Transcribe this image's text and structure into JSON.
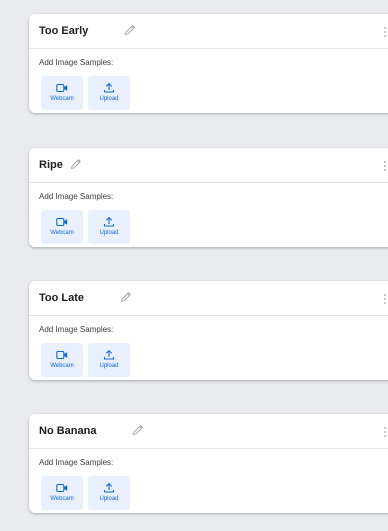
{
  "classes": [
    {
      "name": "Too Early",
      "samples_label": "Add Image Samples:",
      "webcam_label": "Webcam",
      "upload_label": "Upload"
    },
    {
      "name": "Ripe",
      "samples_label": "Add Image Samples:",
      "webcam_label": "Webcam",
      "upload_label": "Upload"
    },
    {
      "name": "Too Late",
      "samples_label": "Add Image Samples:",
      "webcam_label": "Webcam",
      "upload_label": "Upload"
    },
    {
      "name": "No Banana",
      "samples_label": "Add Image Samples:",
      "webcam_label": "Webcam",
      "upload_label": "Upload"
    }
  ],
  "icons": {
    "edit": "pencil-icon",
    "more": "more-vert-icon",
    "webcam": "videocam-icon",
    "upload": "upload-icon"
  },
  "colors": {
    "background": "#e8eaed",
    "card": "#ffffff",
    "button_bg": "#e8f0fe",
    "accent": "#1967d2"
  }
}
